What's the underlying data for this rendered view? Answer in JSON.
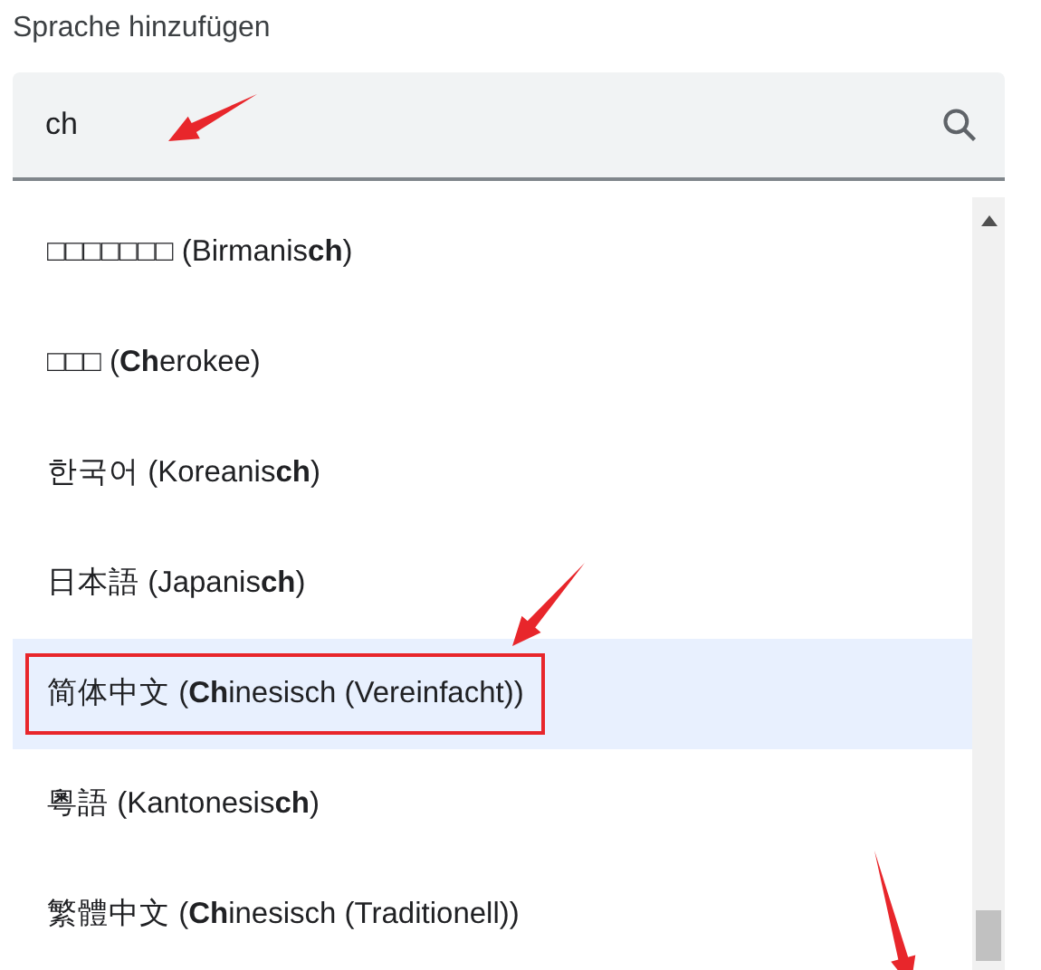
{
  "dialog": {
    "title": "Sprache hinzufügen"
  },
  "search": {
    "value": "ch"
  },
  "languages": [
    {
      "label": "□□□□□□□ (Birmanis**ch**)",
      "selected": false,
      "marked": false
    },
    {
      "label": "□□□ (**Ch**erokee)",
      "selected": false,
      "marked": false
    },
    {
      "label": "한국어 (Koreanis**ch**)",
      "selected": false,
      "marked": false
    },
    {
      "label": "日本語 (Japanis**ch**)",
      "selected": false,
      "marked": false
    },
    {
      "label": "简体中文 (**Ch**inesisch (Vereinfacht))",
      "selected": true,
      "marked": true
    },
    {
      "label": "粵語 (Kantonesis**ch**)",
      "selected": false,
      "marked": false
    },
    {
      "label": "繁體中文 (**Ch**inesisch (Traditionell))",
      "selected": false,
      "marked": false
    }
  ]
}
